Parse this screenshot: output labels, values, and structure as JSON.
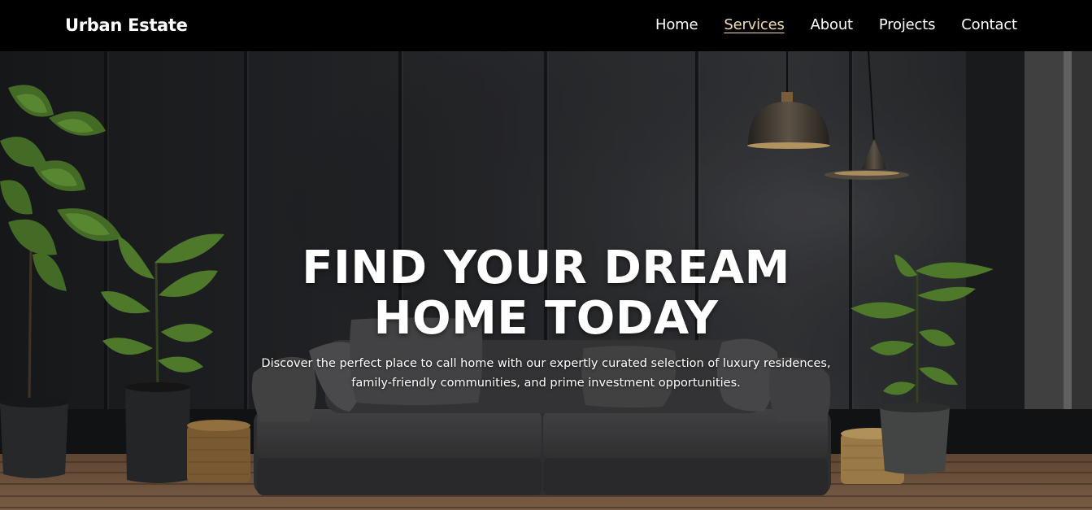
{
  "brand": {
    "name": "Urban Estate"
  },
  "nav": {
    "items": [
      {
        "label": "Home",
        "active": false
      },
      {
        "label": "Services",
        "active": true
      },
      {
        "label": "About",
        "active": false
      },
      {
        "label": "Projects",
        "active": false
      },
      {
        "label": "Contact",
        "active": false
      }
    ]
  },
  "hero": {
    "title": "FIND YOUR DREAM HOME TODAY",
    "subtitle": "Discover the perfect place to call home with our expertly curated selection of luxury residences, family-friendly communities, and prime investment opportunities.",
    "background_image": "dark-living-room-with-sofa-plants-pendant-lamps"
  },
  "colors": {
    "navbar_bg": "#000000",
    "nav_text": "#ffffff",
    "nav_active": "#f2dcb8",
    "hero_text": "#ffffff"
  }
}
